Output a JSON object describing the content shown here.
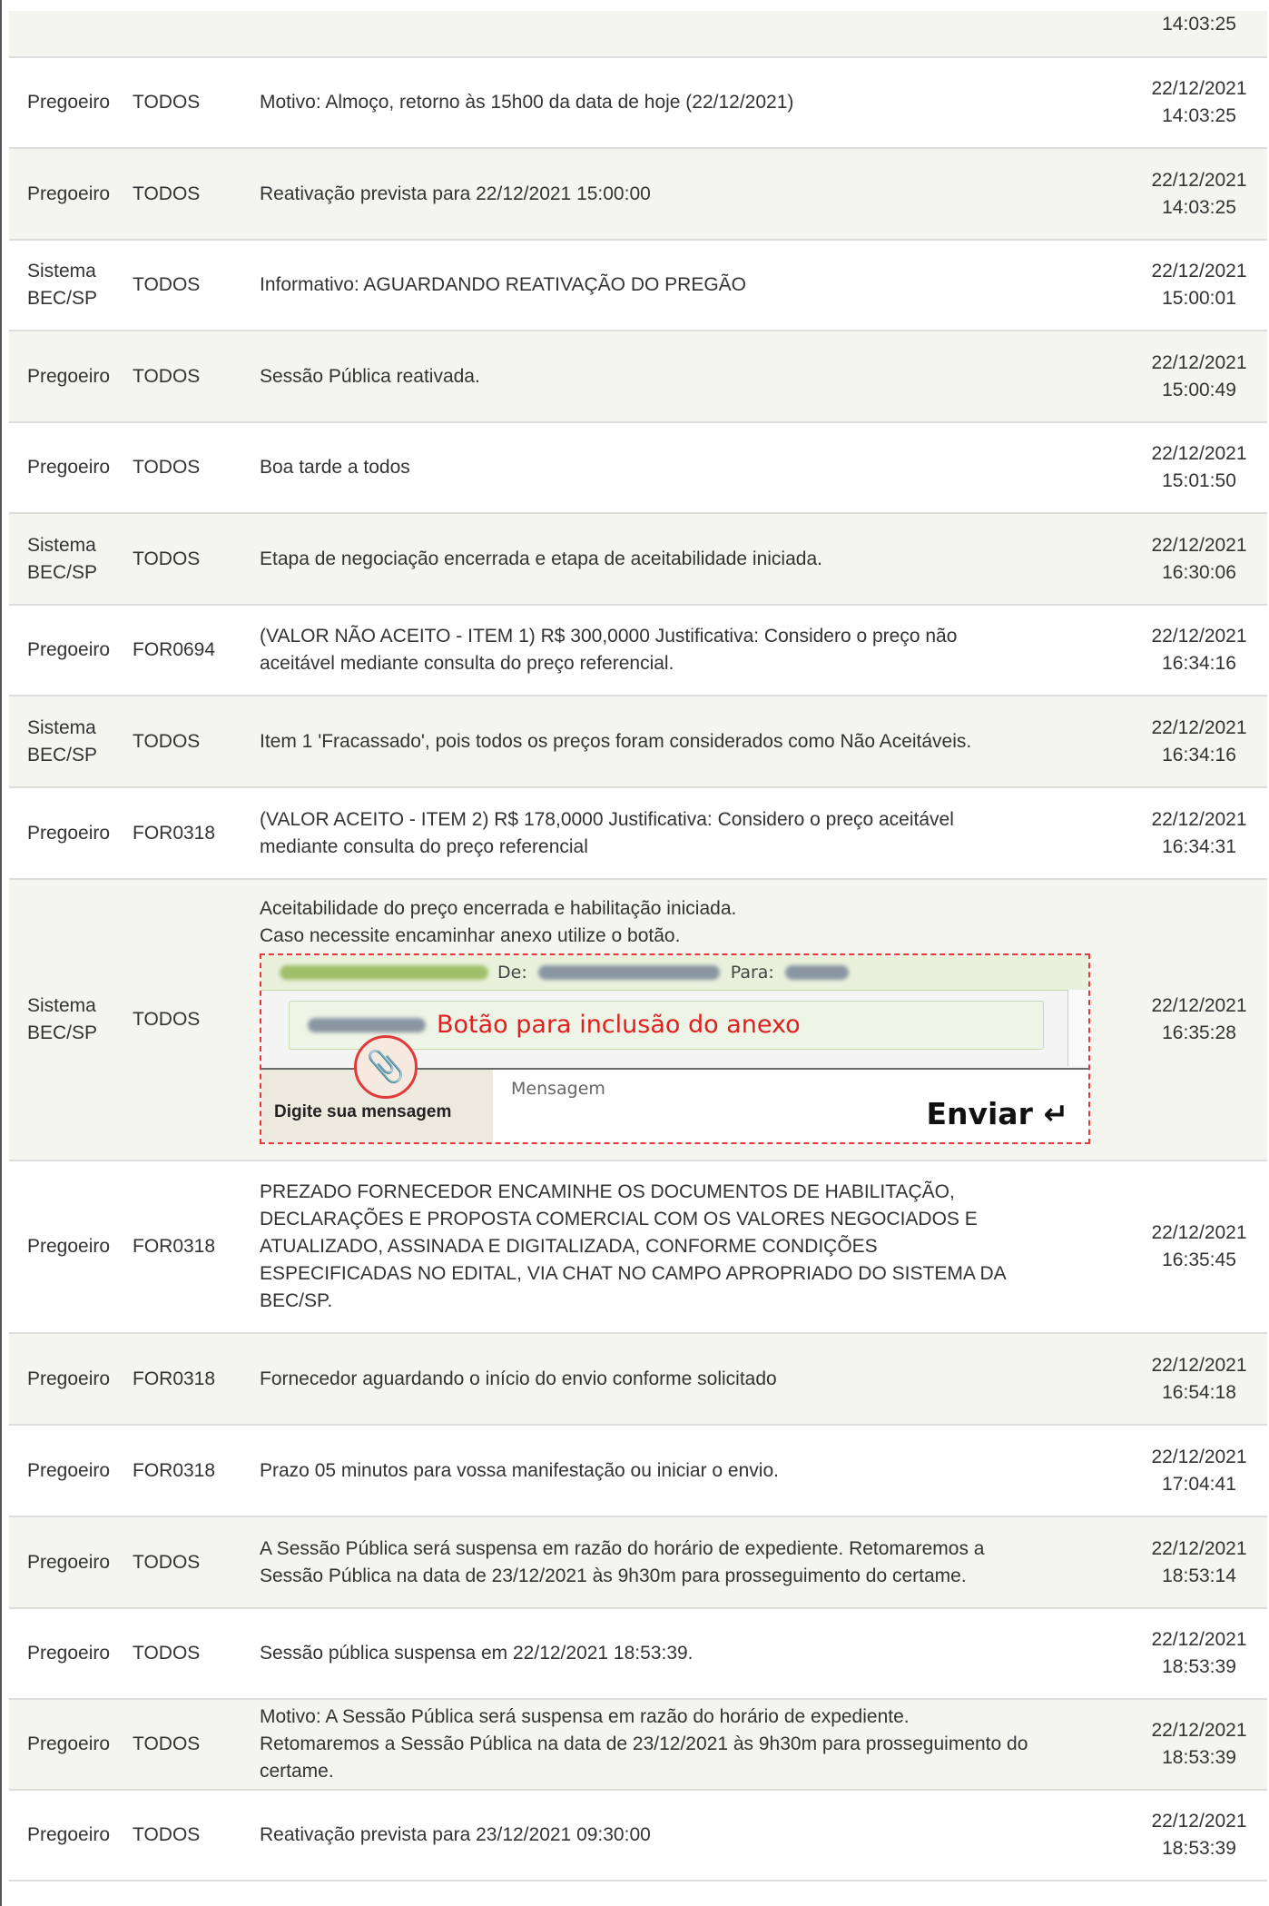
{
  "top_row": {
    "time": "14:03:25"
  },
  "rows": [
    {
      "from": [
        "Pregoeiro"
      ],
      "to": "TODOS",
      "msg": [
        "Motivo: Almoço, retorno às 15h00 da data de hoje (22/12/2021)"
      ],
      "date": "22/12/2021",
      "time": "14:03:25"
    },
    {
      "from": [
        "Pregoeiro"
      ],
      "to": "TODOS",
      "msg": [
        "Reativação prevista para 22/12/2021 15:00:00"
      ],
      "date": "22/12/2021",
      "time": "14:03:25"
    },
    {
      "from": [
        "Sistema",
        "BEC/SP"
      ],
      "to": "TODOS",
      "msg": [
        "Informativo: AGUARDANDO REATIVAÇÃO DO PREGÃO"
      ],
      "date": "22/12/2021",
      "time": "15:00:01"
    },
    {
      "from": [
        "Pregoeiro"
      ],
      "to": "TODOS",
      "msg": [
        "Sessão Pública reativada."
      ],
      "date": "22/12/2021",
      "time": "15:00:49"
    },
    {
      "from": [
        "Pregoeiro"
      ],
      "to": "TODOS",
      "msg": [
        "Boa tarde a todos"
      ],
      "date": "22/12/2021",
      "time": "15:01:50"
    },
    {
      "from": [
        "Sistema",
        "BEC/SP"
      ],
      "to": "TODOS",
      "msg": [
        "Etapa de negociação encerrada e etapa de aceitabilidade iniciada."
      ],
      "date": "22/12/2021",
      "time": "16:30:06"
    },
    {
      "from": [
        "Pregoeiro"
      ],
      "to": "FOR0694",
      "msg": [
        "(VALOR NÃO ACEITO - ITEM 1) R$ 300,0000 Justificativa: Considero o preço não",
        "aceitável mediante consulta do preço referencial."
      ],
      "date": "22/12/2021",
      "time": "16:34:16"
    },
    {
      "from": [
        "Sistema",
        "BEC/SP"
      ],
      "to": "TODOS",
      "msg": [
        "Item 1 'Fracassado', pois todos os preços foram considerados como Não Aceitáveis."
      ],
      "date": "22/12/2021",
      "time": "16:34:16"
    },
    {
      "from": [
        "Pregoeiro"
      ],
      "to": "FOR0318",
      "msg": [
        "(VALOR ACEITO - ITEM 2) R$ 178,0000 Justificativa: Considero o preço aceitável",
        "mediante consulta do preço referencial"
      ],
      "date": "22/12/2021",
      "time": "16:34:31"
    },
    {
      "from": [
        "Sistema",
        "BEC/SP"
      ],
      "to": "TODOS",
      "msg": [
        "Aceitabilidade do preço encerrada e habilitação iniciada.",
        "Caso necessite encaminhar anexo utilize o botão."
      ],
      "date": "22/12/2021",
      "time": "16:35:28",
      "image": true
    },
    {
      "from": [
        "Pregoeiro"
      ],
      "to": "FOR0318",
      "msg": [
        "PREZADO FORNECEDOR ENCAMINHE OS DOCUMENTOS DE HABILITAÇÃO,",
        "DECLARAÇÕES E PROPOSTA COMERCIAL COM OS VALORES NEGOCIADOS E",
        "ATUALIZADO, ASSINADA E DIGITALIZADA, CONFORME CONDIÇÕES",
        "ESPECIFICADAS NO EDITAL, VIA CHAT NO CAMPO APROPRIADO DO SISTEMA DA",
        "BEC/SP."
      ],
      "date": "22/12/2021",
      "time": "16:35:45"
    },
    {
      "from": [
        "Pregoeiro"
      ],
      "to": "FOR0318",
      "msg": [
        "Fornecedor aguardando o início do envio conforme solicitado"
      ],
      "date": "22/12/2021",
      "time": "16:54:18"
    },
    {
      "from": [
        "Pregoeiro"
      ],
      "to": "FOR0318",
      "msg": [
        "Prazo 05 minutos para vossa manifestação ou iniciar o envio."
      ],
      "date": "22/12/2021",
      "time": "17:04:41"
    },
    {
      "from": [
        "Pregoeiro"
      ],
      "to": "TODOS",
      "msg": [
        "A Sessão Pública será suspensa em razão do horário de expediente. Retomaremos a",
        "Sessão Pública na data de 23/12/2021 às 9h30m para prosseguimento do certame."
      ],
      "date": "22/12/2021",
      "time": "18:53:14"
    },
    {
      "from": [
        "Pregoeiro"
      ],
      "to": "TODOS",
      "msg": [
        "Sessão pública suspensa em 22/12/2021 18:53:39."
      ],
      "date": "22/12/2021",
      "time": "18:53:39"
    },
    {
      "from": [
        "Pregoeiro"
      ],
      "to": "TODOS",
      "msg": [
        "Motivo: A Sessão Pública será suspensa em razão do horário de expediente.",
        "Retomaremos a Sessão Pública na data de 23/12/2021 às 9h30m para prosseguimento do",
        "certame."
      ],
      "date": "22/12/2021",
      "time": "18:53:39"
    },
    {
      "from": [
        "Pregoeiro"
      ],
      "to": "TODOS",
      "msg": [
        "Reativação prevista para 23/12/2021 09:30:00"
      ],
      "date": "22/12/2021",
      "time": "18:53:39"
    }
  ],
  "embedded_image": {
    "de_label": "De:",
    "para_label": "Para:",
    "annotation": "Botão para inclusão do anexo",
    "tab_label": "Digite sua mensagem",
    "message_placeholder": "Mensagem",
    "send_label": "Enviar ↵",
    "attach_icon": "paperclip-icon",
    "annotation_color": "#e02020"
  }
}
